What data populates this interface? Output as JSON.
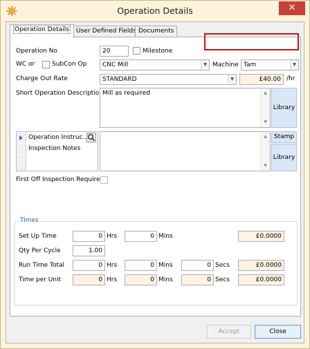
{
  "window": {
    "title": "Operation Details",
    "close_glyph": "✕",
    "app_icon": "sun-gear-icon"
  },
  "tabs": [
    {
      "label": "Operation Details",
      "active": true
    },
    {
      "label": "User Defined Fields",
      "active": false
    },
    {
      "label": "Documents",
      "active": false
    }
  ],
  "form": {
    "operation_no_label": "Operation No",
    "operation_no": "20",
    "milestone_label": "Milestone",
    "wc_or_label": "WC or",
    "subcon_label": "SubCon Op",
    "work_centre": "CNC Mill",
    "machine_label": "Machine",
    "machine": "Tam",
    "charge_out_label": "Charge Out Rate",
    "charge_out_rate": "STANDARD",
    "rate_value": "£40.00",
    "rate_unit": "/hr",
    "short_desc_label": "Short Operation Description",
    "short_desc": "Mill as required",
    "library_label": "Library",
    "stamp_label": "Stamp",
    "library2_label": "Library",
    "notes_grid": [
      "Operation Instruc...",
      "Inspection Notes"
    ],
    "first_off_label": "First Off Inspection Required"
  },
  "times": {
    "group_title": "Times",
    "setup_label": "Set Up Time",
    "setup_hrs": "0",
    "setup_mins": "0",
    "setup_cost": "£0.0000",
    "qty_label": "Qty Per Cycle",
    "qty": "1.00",
    "run_label": "Run Time Total",
    "run_hrs": "0",
    "run_mins": "0",
    "run_secs": "0",
    "run_cost": "£0.0000",
    "unit_label": "Time per Unit",
    "unit_hrs": "0",
    "unit_mins": "0",
    "unit_secs": "0",
    "unit_cost": "£0.0000",
    "hrs_unit": "Hrs",
    "mins_unit": "Mins",
    "secs_unit": "Secs"
  },
  "buttons": {
    "accept": "Accept",
    "close": "Close"
  },
  "colors": {
    "highlight_box": "#d01010",
    "readonly_fill": "#fdf2e3",
    "group_title": "#1e5eb8"
  }
}
